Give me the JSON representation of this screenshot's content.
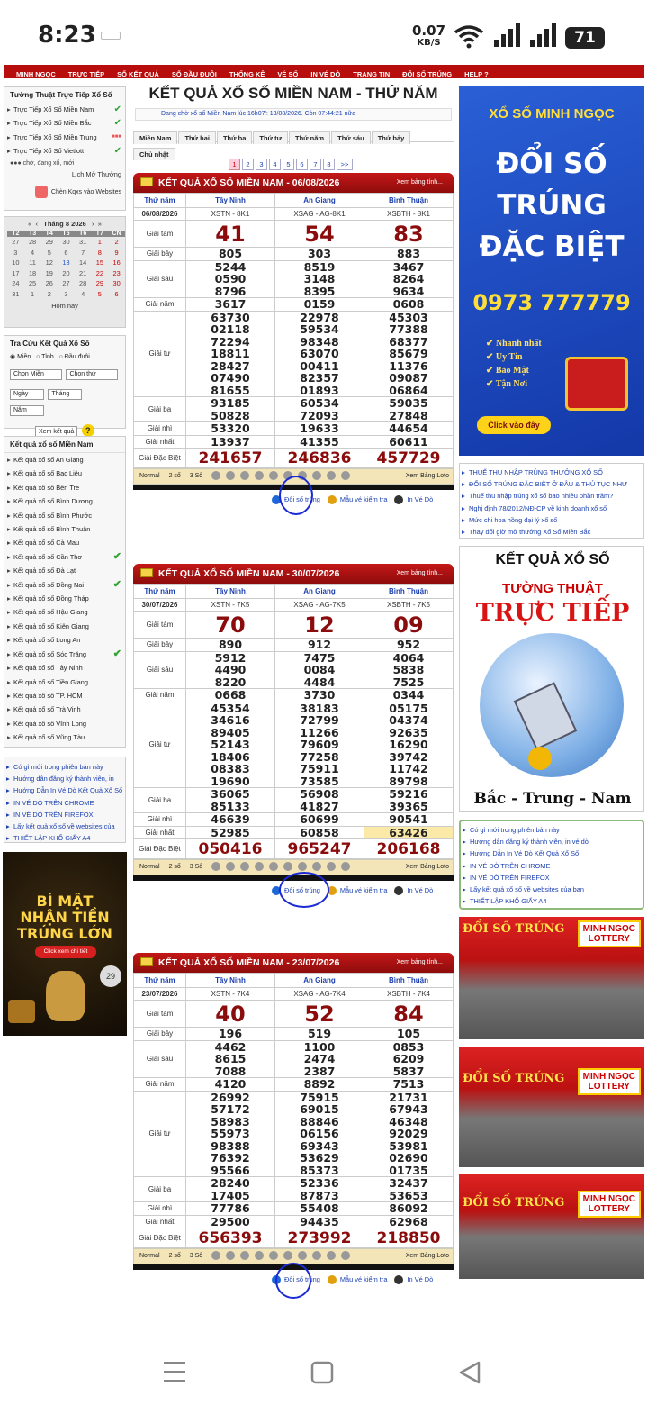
{
  "status": {
    "time": "8:23",
    "speed": "0.07",
    "speed_unit": "KB/S",
    "battery": "71"
  },
  "nav": [
    "MINH NGỌC",
    "TRỰC TIẾP",
    "SỔ KẾT QUẢ",
    "SỔ ĐẦU ĐUÔI",
    "THỐNG KÊ",
    "VÉ SỐ",
    "IN VÉ DÒ",
    "TRANG TIN",
    "ĐỔI SỐ TRÚNG",
    "HELP ?"
  ],
  "left": {
    "live_title": "Tường Thuật Trực Tiếp Xổ Số",
    "live_items": [
      "Trực Tiếp Xổ Số Miền Nam",
      "Trực Tiếp Xổ Số Miền Bắc",
      "Trực Tiếp Xổ Số Miền Trung",
      "Trực Tiếp Xổ Số Vietlott"
    ],
    "legend": "chờ,  đang xổ,  mới",
    "schedule": "Lịch Mở Thưởng",
    "embed": "Chèn Kqxs vào Websites",
    "cal_month": "Tháng 8 2026",
    "cal_head": [
      "T2",
      "T3",
      "T4",
      "T5",
      "T6",
      "T7",
      "CN"
    ],
    "cal_rows": [
      [
        "27",
        "28",
        "29",
        "30",
        "31",
        "1",
        "2"
      ],
      [
        "3",
        "4",
        "5",
        "6",
        "7",
        "8",
        "9"
      ],
      [
        "10",
        "11",
        "12",
        "13",
        "14",
        "15",
        "16"
      ],
      [
        "17",
        "18",
        "19",
        "20",
        "21",
        "22",
        "23"
      ],
      [
        "24",
        "25",
        "26",
        "27",
        "28",
        "29",
        "30"
      ],
      [
        "31",
        "1",
        "2",
        "3",
        "4",
        "5",
        "6"
      ]
    ],
    "today": "Hôm nay",
    "lookup_title": "Tra Cứu Kết Quả Xổ Số",
    "regions": [
      "Miền",
      "Tỉnh",
      "Đầu đuôi"
    ],
    "sel1": "Chọn Miền",
    "sel2": "Chọn thứ",
    "sel3": "Ngày",
    "sel4": "Tháng",
    "sel5": "Năm",
    "lookup_btn": "Xem kết quả",
    "prov_title": "Kết quả xổ số Miền Nam",
    "provinces": [
      "Kết quả xổ số An Giang",
      "Kết quả xổ số Bạc Liêu",
      "Kết quả xổ số Bến Tre",
      "Kết quả xổ số Bình Dương",
      "Kết quả xổ số Bình Phước",
      "Kết quả xổ số Bình Thuận",
      "Kết quả xổ số Cà Mau",
      "Kết quả xổ số Cần Thơ",
      "Kết quả xổ số Đà Lạt",
      "Kết quả xổ số Đồng Nai",
      "Kết quả xổ số Đồng Tháp",
      "Kết quả xổ số Hậu Giang",
      "Kết quả xổ số Kiên Giang",
      "Kết quả xổ số Long An",
      "Kết quả xổ số Sóc Trăng",
      "Kết quả xổ số Tây Ninh",
      "Kết quả xổ số Tiền Giang",
      "Kết quả xổ số TP. HCM",
      "Kết quả xổ số Trà Vinh",
      "Kết quả xổ số Vĩnh Long",
      "Kết quả xổ số Vũng Tàu"
    ],
    "extra_links": [
      "Có gì mới trong phiên bản này",
      "Hướng dẫn đăng ký thành viên, in",
      "Hướng Dẫn In Vé Dò Kết Quả Xổ Số",
      "IN VÉ DÒ TRÊN CHROME",
      "IN VÉ DÒ TRÊN FIREFOX",
      "Lấy kết quả xổ số về websites của",
      "THIẾT LẬP KHỔ GIẤY A4"
    ],
    "ad_line1": "BÍ MẬT",
    "ad_line2": "NHẬN TIỀN",
    "ad_line3": "TRÚNG LỚN",
    "ad_btn": "Click xem chi tiết"
  },
  "center": {
    "title": "KẾT QUẢ XỔ SỐ MIỀN NAM - THỨ NĂM",
    "countdown": "Đang chờ xổ số Miền Nam lúc 16h07': 13/08/2026. Còn 07:44:21 nữa",
    "days": [
      "Miền Nam",
      "Thứ hai",
      "Thứ ba",
      "Thứ tư",
      "Thứ năm",
      "Thứ sáu",
      "Thứ bảy",
      "Chủ nhật"
    ],
    "pages": [
      "1",
      "2",
      "3",
      "4",
      "5",
      "6",
      "7",
      "8",
      ">>"
    ],
    "footer_types": [
      "Normal",
      "2 số",
      "3 Số"
    ],
    "loto": "Xem Bảng Loto",
    "action_links": [
      "Đổi số trúng",
      "Mẫu vé kiểm tra",
      "In Vé Dò"
    ],
    "results": [
      {
        "title": "KẾT QUẢ XỔ SỐ MIỀN NAM - 06/08/2026",
        "xem": "Xem bảng tính...",
        "day": "Thứ năm",
        "date": "06/08/2026",
        "provs": [
          "Tây Ninh",
          "An Giang",
          "Bình Thuận"
        ],
        "codes": [
          "XSTN - 8K1",
          "XSAG - AG-8K1",
          "XSBTH - 8K1"
        ],
        "prizes": {
          "g8": [
            "41",
            "54",
            "83"
          ],
          "g7": [
            "805",
            "303",
            "883"
          ],
          "g6": [
            "5244\n0590\n8796",
            "8519\n3148\n8395",
            "3467\n8264\n9634"
          ],
          "g5": [
            "3617",
            "0159",
            "0608"
          ],
          "g4": [
            "63730\n02118\n72294\n18811\n28427\n07490\n81655",
            "22978\n59534\n98348\n63070\n00411\n82357\n01893",
            "45303\n77388\n68377\n85679\n11376\n09087\n06864"
          ],
          "g3": [
            "93185\n50828",
            "60534\n72093",
            "59035\n27848"
          ],
          "g2": [
            "53320",
            "19633",
            "44654"
          ],
          "g1": [
            "13937",
            "41355",
            "60611"
          ],
          "db": [
            "241657",
            "246836",
            "457729"
          ]
        }
      },
      {
        "title": "KẾT QUẢ XỔ SỐ MIỀN NAM - 30/07/2026",
        "xem": "Xem bảng tính...",
        "day": "Thứ năm",
        "date": "30/07/2026",
        "provs": [
          "Tây Ninh",
          "An Giang",
          "Bình Thuận"
        ],
        "codes": [
          "XSTN - 7K5",
          "XSAG - AG-7K5",
          "XSBTH - 7K5"
        ],
        "prizes": {
          "g8": [
            "70",
            "12",
            "09"
          ],
          "g7": [
            "890",
            "912",
            "952"
          ],
          "g6": [
            "5912\n4490\n8220",
            "7475\n0084\n4484",
            "4064\n5838\n7525"
          ],
          "g5": [
            "0668",
            "3730",
            "0344"
          ],
          "g4": [
            "45354\n34616\n89405\n52143\n18406\n08383\n19690",
            "38183\n72799\n11266\n79609\n77258\n75911\n73585",
            "05175\n04374\n92635\n16290\n39742\n11742\n89798"
          ],
          "g3": [
            "36065\n85133",
            "56908\n41827",
            "59216\n39365"
          ],
          "g2": [
            "46639",
            "60699",
            "90541"
          ],
          "g1": [
            "52985",
            "60858",
            "63426"
          ],
          "db": [
            "050416",
            "965247",
            "206168"
          ]
        }
      },
      {
        "title": "KẾT QUẢ XỔ SỐ MIỀN NAM - 23/07/2026",
        "xem": "Xem bảng tính...",
        "day": "Thứ năm",
        "date": "23/07/2026",
        "provs": [
          "Tây Ninh",
          "An Giang",
          "Bình Thuận"
        ],
        "codes": [
          "XSTN - 7K4",
          "XSAG - AG-7K4",
          "XSBTH - 7K4"
        ],
        "prizes": {
          "g8": [
            "40",
            "52",
            "84"
          ],
          "g7": [
            "196",
            "519",
            "105"
          ],
          "g6": [
            "4462\n8615\n7088",
            "1100\n2474\n2387",
            "0853\n6209\n5837"
          ],
          "g5": [
            "4120",
            "8892",
            "7513"
          ],
          "g4": [
            "26992\n57172\n58983\n55973\n98388\n76392\n95566",
            "75915\n69015\n88846\n06156\n69343\n53629\n85373",
            "21731\n67943\n46348\n92029\n53981\n02690\n01735"
          ],
          "g3": [
            "28240\n17405",
            "52336\n87873",
            "32437\n53653"
          ],
          "g2": [
            "77786",
            "55408",
            "86092"
          ],
          "g1": [
            "29500",
            "94435",
            "62968"
          ],
          "db": [
            "656393",
            "273992",
            "218850"
          ]
        }
      }
    ],
    "labels": {
      "g8": "Giải tám",
      "g7": "Giải bảy",
      "g6": "Giải sáu",
      "g5": "Giải năm",
      "g4": "Giải tư",
      "g3": "Giải ba",
      "g2": "Giải nhì",
      "g1": "Giải nhất",
      "db": "Giải Đặc Biệt"
    }
  },
  "right": {
    "ad1_top": "XỔ SỐ MINH NGỌC",
    "ad1_l1": "ĐỔI SỐ",
    "ad1_l2": "TRÚNG",
    "ad1_l3": "ĐẶC BIỆT",
    "ad1_phone": "0973 777779",
    "ad1_bullets": [
      "Nhanh nhất",
      "Uy Tín",
      "Bảo Mật",
      "Tận Nơi"
    ],
    "ad1_btn": "Click vào đây",
    "news": [
      "THUẾ THU NHẬP TRÚNG THƯỞNG XỔ SỐ",
      "ĐỔI SỐ TRÚNG ĐẶC BIỆT Ở ĐÂU & THỦ TỤC NHƯ",
      "Thuế thu nhập trúng xổ số bao nhiêu phần trăm?",
      "Nghị định 78/2012/NĐ-CP về kinh doanh xổ số",
      "Mức chi hoa hồng đại lý xổ số",
      "Thay đổi giờ mở thưởng Xổ Số Miền Bắc"
    ],
    "ad2_t1": "KẾT QUẢ XỔ SỐ",
    "ad2_t2": "TƯỜNG THUẬT",
    "ad2_t3": "TRỰC TIẾP",
    "ad2_t4": "Bắc - Trung - Nam",
    "links": [
      "Có gì mới trong phiên bản này",
      "Hướng dẫn đăng ký thành viên, in vé dò",
      "Hướng Dẫn In Vé Dò Kết Quả Xổ Số",
      "IN VÉ DÒ TRÊN CHROME",
      "IN VÉ DÒ TRÊN FIREFOX",
      "Lấy kết quả xổ số về websites của ban",
      "THIẾT LẬP KHỔ GIẤY A4"
    ],
    "shop_sign": "ĐỔI SỐ TRÚNG",
    "shop_sign2": "MINH NGỌC\nLOTTERY"
  }
}
